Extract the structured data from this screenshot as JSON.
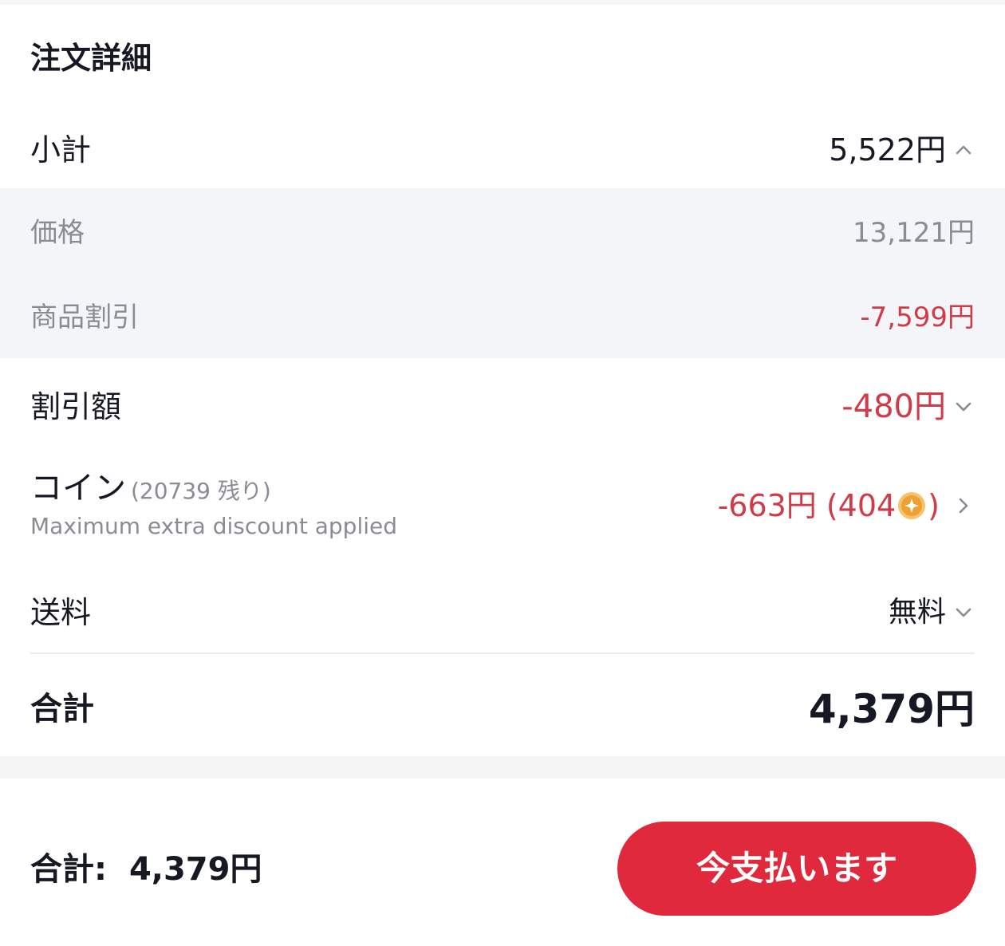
{
  "order_details": {
    "title": "注文詳細",
    "subtotal": {
      "label": "小計",
      "value": "5,522円"
    },
    "breakdown": {
      "price": {
        "label": "価格",
        "value": "13,121円"
      },
      "product_discount": {
        "label": "商品割引",
        "value": "-7,599円"
      }
    },
    "discount": {
      "label": "割引額",
      "value": "-480円"
    },
    "coin": {
      "label": "コイン",
      "remaining": "(20739 残り)",
      "note": "Maximum extra discount applied",
      "value": "-663円",
      "coin_amount_open": "(404",
      "coin_amount_close": ")"
    },
    "shipping": {
      "label": "送料",
      "value": "無料"
    },
    "total": {
      "label": "合計",
      "value": "4,379円"
    }
  },
  "bottom_bar": {
    "total_label": "合計:",
    "total_value": "4,379円",
    "pay_button_label": "今支払います"
  },
  "colors": {
    "accent_red": "#e0293d",
    "discount_red": "#d13a47",
    "muted_gray": "#8a8b93",
    "coin_orange": "#f0a030"
  }
}
